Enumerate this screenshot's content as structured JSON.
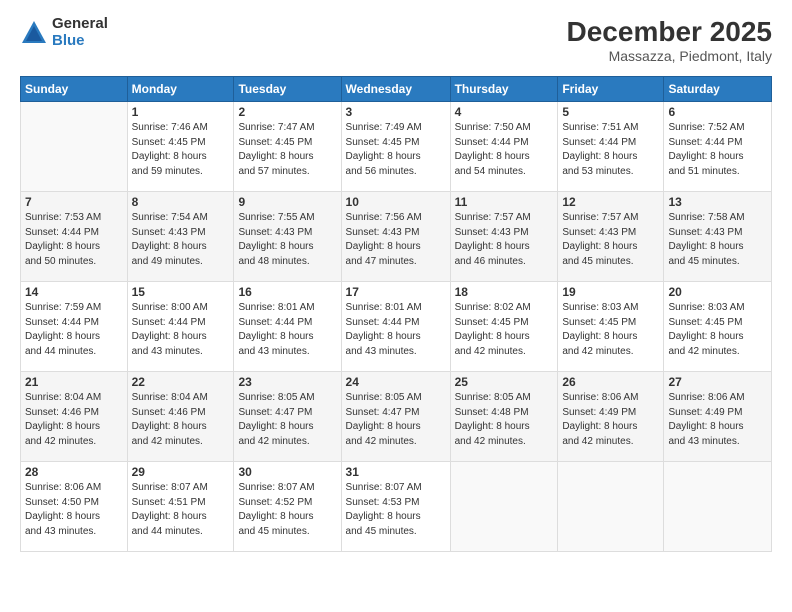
{
  "logo": {
    "general": "General",
    "blue": "Blue"
  },
  "title": "December 2025",
  "location": "Massazza, Piedmont, Italy",
  "days_of_week": [
    "Sunday",
    "Monday",
    "Tuesday",
    "Wednesday",
    "Thursday",
    "Friday",
    "Saturday"
  ],
  "weeks": [
    [
      {
        "day": "",
        "info": ""
      },
      {
        "day": "1",
        "info": "Sunrise: 7:46 AM\nSunset: 4:45 PM\nDaylight: 8 hours\nand 59 minutes."
      },
      {
        "day": "2",
        "info": "Sunrise: 7:47 AM\nSunset: 4:45 PM\nDaylight: 8 hours\nand 57 minutes."
      },
      {
        "day": "3",
        "info": "Sunrise: 7:49 AM\nSunset: 4:45 PM\nDaylight: 8 hours\nand 56 minutes."
      },
      {
        "day": "4",
        "info": "Sunrise: 7:50 AM\nSunset: 4:44 PM\nDaylight: 8 hours\nand 54 minutes."
      },
      {
        "day": "5",
        "info": "Sunrise: 7:51 AM\nSunset: 4:44 PM\nDaylight: 8 hours\nand 53 minutes."
      },
      {
        "day": "6",
        "info": "Sunrise: 7:52 AM\nSunset: 4:44 PM\nDaylight: 8 hours\nand 51 minutes."
      }
    ],
    [
      {
        "day": "7",
        "info": "Sunrise: 7:53 AM\nSunset: 4:44 PM\nDaylight: 8 hours\nand 50 minutes."
      },
      {
        "day": "8",
        "info": "Sunrise: 7:54 AM\nSunset: 4:43 PM\nDaylight: 8 hours\nand 49 minutes."
      },
      {
        "day": "9",
        "info": "Sunrise: 7:55 AM\nSunset: 4:43 PM\nDaylight: 8 hours\nand 48 minutes."
      },
      {
        "day": "10",
        "info": "Sunrise: 7:56 AM\nSunset: 4:43 PM\nDaylight: 8 hours\nand 47 minutes."
      },
      {
        "day": "11",
        "info": "Sunrise: 7:57 AM\nSunset: 4:43 PM\nDaylight: 8 hours\nand 46 minutes."
      },
      {
        "day": "12",
        "info": "Sunrise: 7:57 AM\nSunset: 4:43 PM\nDaylight: 8 hours\nand 45 minutes."
      },
      {
        "day": "13",
        "info": "Sunrise: 7:58 AM\nSunset: 4:43 PM\nDaylight: 8 hours\nand 45 minutes."
      }
    ],
    [
      {
        "day": "14",
        "info": "Sunrise: 7:59 AM\nSunset: 4:44 PM\nDaylight: 8 hours\nand 44 minutes."
      },
      {
        "day": "15",
        "info": "Sunrise: 8:00 AM\nSunset: 4:44 PM\nDaylight: 8 hours\nand 43 minutes."
      },
      {
        "day": "16",
        "info": "Sunrise: 8:01 AM\nSunset: 4:44 PM\nDaylight: 8 hours\nand 43 minutes."
      },
      {
        "day": "17",
        "info": "Sunrise: 8:01 AM\nSunset: 4:44 PM\nDaylight: 8 hours\nand 43 minutes."
      },
      {
        "day": "18",
        "info": "Sunrise: 8:02 AM\nSunset: 4:45 PM\nDaylight: 8 hours\nand 42 minutes."
      },
      {
        "day": "19",
        "info": "Sunrise: 8:03 AM\nSunset: 4:45 PM\nDaylight: 8 hours\nand 42 minutes."
      },
      {
        "day": "20",
        "info": "Sunrise: 8:03 AM\nSunset: 4:45 PM\nDaylight: 8 hours\nand 42 minutes."
      }
    ],
    [
      {
        "day": "21",
        "info": "Sunrise: 8:04 AM\nSunset: 4:46 PM\nDaylight: 8 hours\nand 42 minutes."
      },
      {
        "day": "22",
        "info": "Sunrise: 8:04 AM\nSunset: 4:46 PM\nDaylight: 8 hours\nand 42 minutes."
      },
      {
        "day": "23",
        "info": "Sunrise: 8:05 AM\nSunset: 4:47 PM\nDaylight: 8 hours\nand 42 minutes."
      },
      {
        "day": "24",
        "info": "Sunrise: 8:05 AM\nSunset: 4:47 PM\nDaylight: 8 hours\nand 42 minutes."
      },
      {
        "day": "25",
        "info": "Sunrise: 8:05 AM\nSunset: 4:48 PM\nDaylight: 8 hours\nand 42 minutes."
      },
      {
        "day": "26",
        "info": "Sunrise: 8:06 AM\nSunset: 4:49 PM\nDaylight: 8 hours\nand 42 minutes."
      },
      {
        "day": "27",
        "info": "Sunrise: 8:06 AM\nSunset: 4:49 PM\nDaylight: 8 hours\nand 43 minutes."
      }
    ],
    [
      {
        "day": "28",
        "info": "Sunrise: 8:06 AM\nSunset: 4:50 PM\nDaylight: 8 hours\nand 43 minutes."
      },
      {
        "day": "29",
        "info": "Sunrise: 8:07 AM\nSunset: 4:51 PM\nDaylight: 8 hours\nand 44 minutes."
      },
      {
        "day": "30",
        "info": "Sunrise: 8:07 AM\nSunset: 4:52 PM\nDaylight: 8 hours\nand 45 minutes."
      },
      {
        "day": "31",
        "info": "Sunrise: 8:07 AM\nSunset: 4:53 PM\nDaylight: 8 hours\nand 45 minutes."
      },
      {
        "day": "",
        "info": ""
      },
      {
        "day": "",
        "info": ""
      },
      {
        "day": "",
        "info": ""
      }
    ]
  ]
}
